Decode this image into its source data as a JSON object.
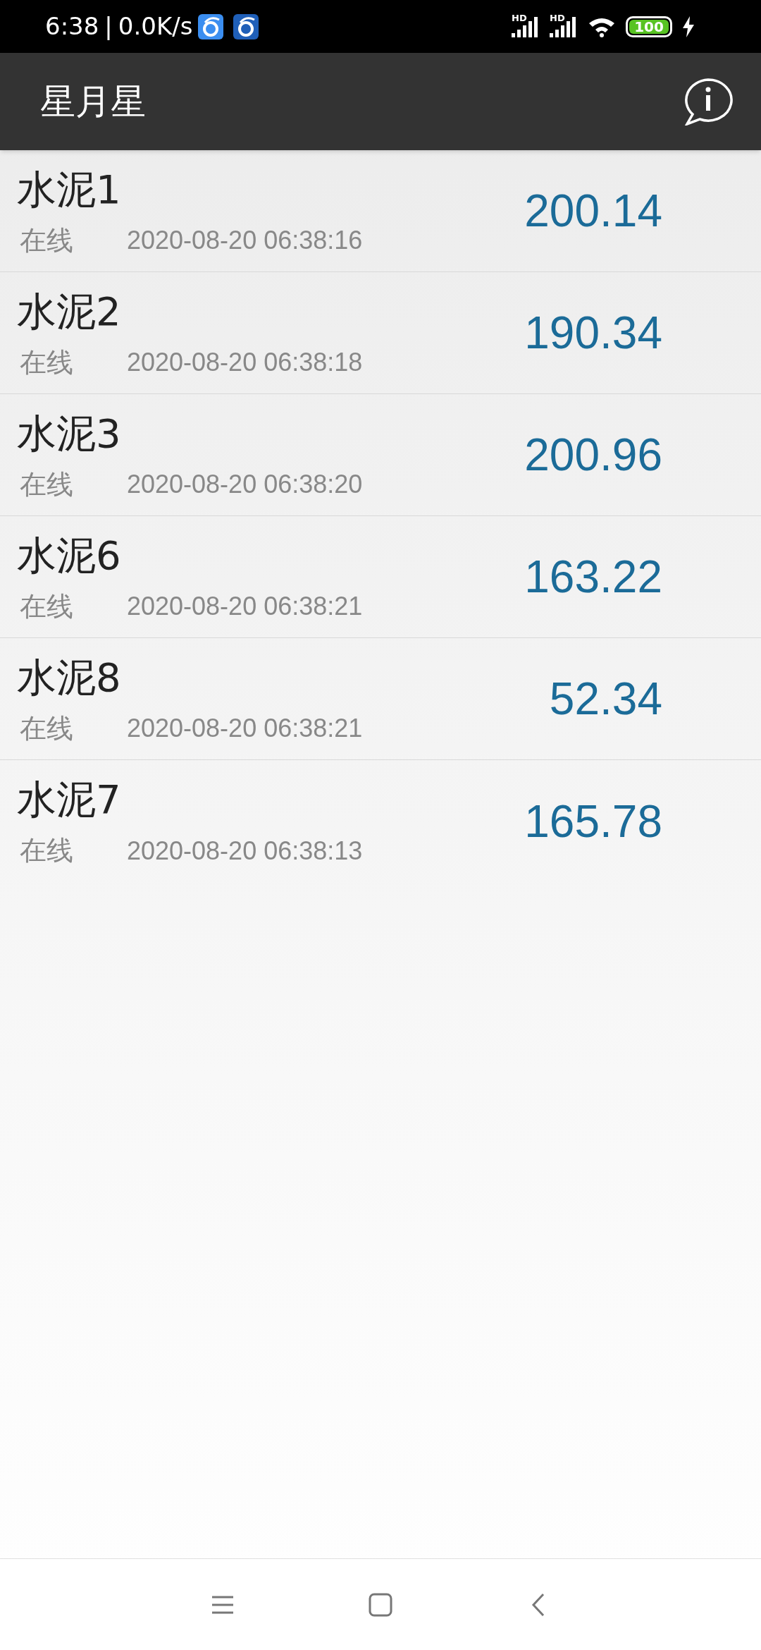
{
  "status_bar": {
    "time": "6:38",
    "separator": "|",
    "speed": "0.0K/s",
    "signal_labels": [
      "HD",
      "HD"
    ],
    "battery": "100"
  },
  "app_bar": {
    "title": "星月星"
  },
  "devices": [
    {
      "name": "水泥1",
      "status": "在线",
      "timestamp": "2020-08-20 06:38:16",
      "value": "200.14"
    },
    {
      "name": "水泥2",
      "status": "在线",
      "timestamp": "2020-08-20 06:38:18",
      "value": "190.34"
    },
    {
      "name": "水泥3",
      "status": "在线",
      "timestamp": "2020-08-20 06:38:20",
      "value": "200.96"
    },
    {
      "name": "水泥6",
      "status": "在线",
      "timestamp": "2020-08-20 06:38:21",
      "value": "163.22"
    },
    {
      "name": "水泥8",
      "status": "在线",
      "timestamp": "2020-08-20 06:38:21",
      "value": "52.34"
    },
    {
      "name": "水泥7",
      "status": "在线",
      "timestamp": "2020-08-20 06:38:13",
      "value": "165.78"
    }
  ]
}
